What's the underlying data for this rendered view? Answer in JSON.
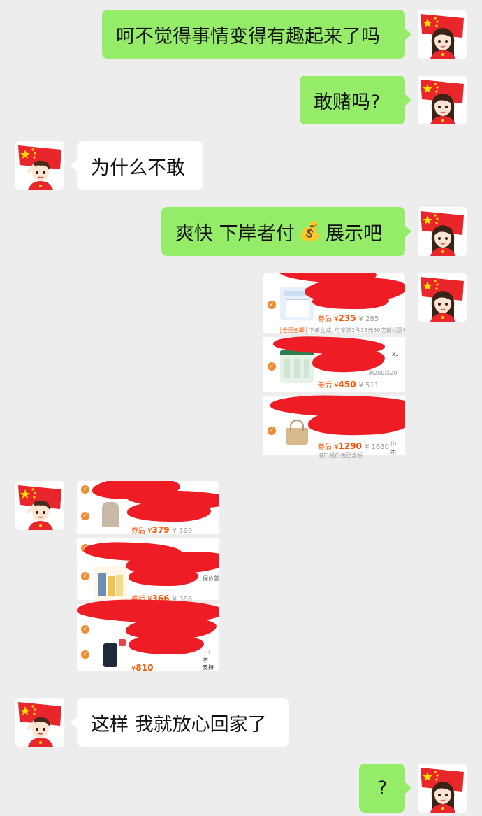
{
  "messages": [
    {
      "side": "me",
      "text": "呵不觉得事情变得有趣起来了吗"
    },
    {
      "side": "me",
      "text": "敢赌吗?"
    },
    {
      "side": "other",
      "text": "为什么不敢"
    },
    {
      "side": "me",
      "text_before": "爽快 下岸者付",
      "emoji": "💰",
      "text_after": "展示吧"
    },
    {
      "side": "other",
      "text": "这样 我就放心回家了"
    },
    {
      "side": "me",
      "text": "?"
    }
  ],
  "screenshot_right": {
    "items": [
      {
        "price_prefix": "券后 ¥",
        "price": "235",
        "orig": "¥ 285",
        "note_tag": "全国包邮",
        "note": "下单立减, 可享满2件38元30店铺优惠券"
      },
      {
        "price_prefix": "券后 ¥",
        "price": "450",
        "orig": "¥ 511",
        "qty": "x1",
        "note": "满200减20"
      },
      {
        "price_prefix": "券后 ¥",
        "price": "1290",
        "orig": "¥ 1630",
        "note": "进口税价包已含税",
        "side_label": "不",
        "side_icon": "(i)"
      }
    ]
  },
  "screenshot_left": {
    "items": [
      {
        "price_prefix": "券后 ¥",
        "price": "379",
        "orig": "¥ 399"
      },
      {
        "price_prefix": "券后 ¥",
        "price": "366",
        "orig": "¥ 386",
        "side_label": "保价普通"
      },
      {
        "price_prefix": "¥",
        "price": "810",
        "side_label": "不\n支持",
        "side_icon": "(i)"
      }
    ]
  },
  "colors": {
    "bg": "#ededed",
    "me_bubble": "#95ec69",
    "other_bubble": "#ffffff",
    "redaction": "#ee1c25",
    "price": "#ff5000"
  }
}
